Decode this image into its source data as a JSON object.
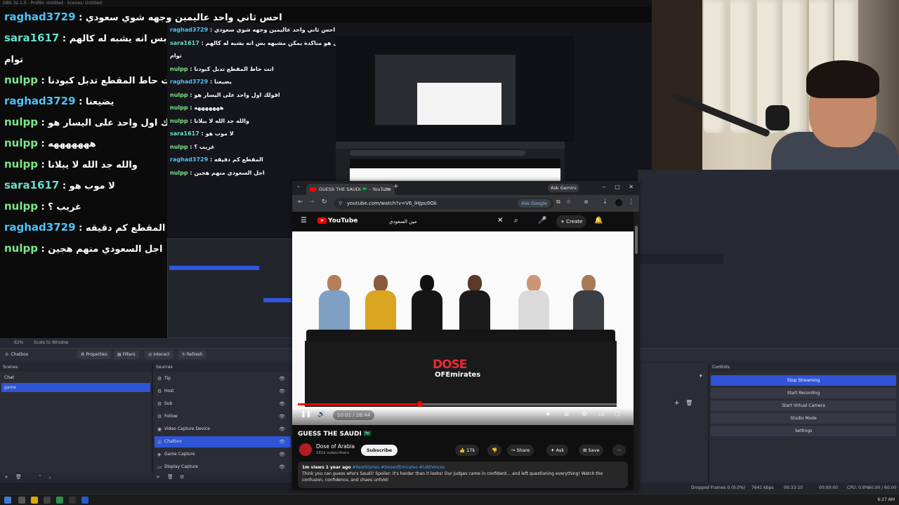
{
  "obs": {
    "title": "OBS 32.1.0 - Profile: Untitled - Scenes: Untitled",
    "source_toolbar": {
      "selected_source": "Chatbox",
      "buttons": [
        "Properties",
        "Filters",
        "Interact",
        "Refresh"
      ]
    },
    "scenes": {
      "header": "Scenes",
      "items": [
        "Chat",
        "game"
      ],
      "active_index": 1
    },
    "sources": {
      "header": "Sources",
      "items": [
        "Tip",
        "Host",
        "Sub",
        "Follow",
        "Video Capture Device",
        "Chatbox",
        "Game Capture",
        "Display Capture"
      ],
      "active_index": 5
    },
    "controls": {
      "header": "Controls",
      "buttons": [
        "Stop Streaming",
        "Start Recording",
        "Start Virtual Camera",
        "Studio Mode",
        "Settings"
      ]
    },
    "status": {
      "dropped_frames": "Dropped Frames 0 (0.0%)",
      "bitrate": "7641 kbps",
      "stream_time": "00:33:10",
      "rec_time": "00:00:00",
      "cpu": "CPU: 0.8%",
      "fps": "60.00 / 60.00 FPS"
    },
    "preview_zoom": "62%",
    "scale_mode": "Scale to Window"
  },
  "chat": {
    "messages": [
      {
        "user": "raghad3729",
        "text": "احس ثاني واحد عاليمين وجهه شوي سعودي",
        "color": "#4fc3f7"
      },
      {
        "user": "sara1617",
        "text": "يمل هو مناكدة يمكن مشبهه بس انه يشبه له كالهم",
        "color": "#66e0c9"
      },
      {
        "user": "",
        "text": "توام",
        "color": "#66e0c9"
      },
      {
        "user": "nulpp",
        "text": "انت حاط المقطع تدبل كبودنا",
        "color": "#7ee787"
      },
      {
        "user": "raghad3729",
        "text": "يضيعنا",
        "color": "#4fc3f7"
      },
      {
        "user": "nulpp",
        "text": "اقولك اول واحد على اليسار هو",
        "color": "#7ee787"
      },
      {
        "user": "nulpp",
        "text": "هههههههه",
        "color": "#7ee787"
      },
      {
        "user": "nulpp",
        "text": "والله جد الله لا يبلانا",
        "color": "#7ee787"
      },
      {
        "user": "sara1617",
        "text": "لا موب هو",
        "color": "#66e0c9"
      },
      {
        "user": "nulpp",
        "text": "غريب ؟",
        "color": "#7ee787"
      },
      {
        "user": "raghad3729",
        "text": "المقطع كم دقيقه",
        "color": "#4fc3f7"
      },
      {
        "user": "nulpp",
        "text": "اجل السعودي منهم هجين",
        "color": "#7ee787"
      }
    ]
  },
  "browser": {
    "tab_title": "GUESS THE SAUDI 🇸🇦 - YouTube",
    "ask_gemini": "Ask Gemini",
    "url": "youtube.com/watch?v=V6_lHjpu9Ok",
    "ask_google": "Ask Google"
  },
  "youtube": {
    "logo": "YouTube",
    "search_query": "مين السعودي",
    "create_label": "Create",
    "time": "10:01 / 26:44",
    "progress": 0.37,
    "video_title": "GUESS THE SAUDI 🇸🇦",
    "channel": "Dose of Arabia",
    "subscribers": "161k subscribers",
    "subscribe_label": "Subscribe",
    "likes": "17k",
    "share": "Share",
    "ask": "Ask",
    "save": "Save",
    "views": "1m views  1 year ago",
    "hashtags": "#RealStories #DoseofEmirates #UAEVoices",
    "description": "Think you can guess who's Saudi? Spoiler: it's harder than it looks! Our judges came in confident... and left questioning everything! Watch the confusion, confidence, and chaos unfold!",
    "logo_dose": "DOSE",
    "logo_sub": "OFEmirates"
  },
  "taskbar": {
    "time": "6:27 AM"
  },
  "colors": {
    "obs_accent": "#2f54d6",
    "yt_red": "#ff0000"
  }
}
